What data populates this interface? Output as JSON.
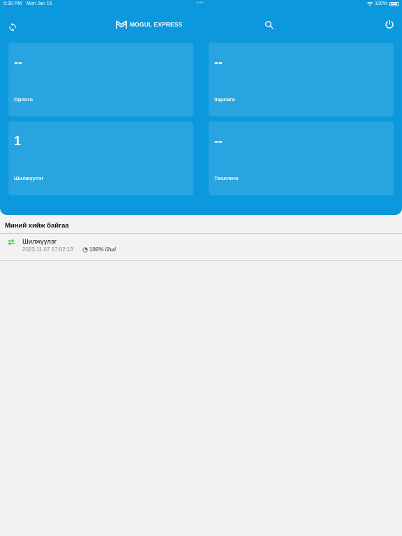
{
  "status_bar": {
    "time": "5:30 PM",
    "date": "Mon Jan 15",
    "battery": "100%"
  },
  "header": {
    "logo_text": "MOGUL EXPRESS"
  },
  "cards": [
    {
      "value": "--",
      "label": "Орлого"
    },
    {
      "value": "--",
      "label": "Зарлага"
    },
    {
      "value": "1",
      "label": "Шилжүүлэг"
    },
    {
      "value": "--",
      "label": "Тооллого"
    }
  ],
  "section": {
    "title": "Миний хийж байгаа"
  },
  "tasks": [
    {
      "title": "Шилжүүлэг",
      "datetime": "2023.11.07 17:02:13",
      "progress": "100% /2ш/"
    }
  ],
  "colors": {
    "primary": "#0b98dc",
    "background": "#f2f2f2",
    "transfer_icon": "#2ecc40"
  },
  "icons": {
    "sync": "sync-icon",
    "search": "search-icon",
    "power": "power-icon",
    "transfer": "transfer-arrows-icon",
    "progress": "pie-progress-icon"
  }
}
